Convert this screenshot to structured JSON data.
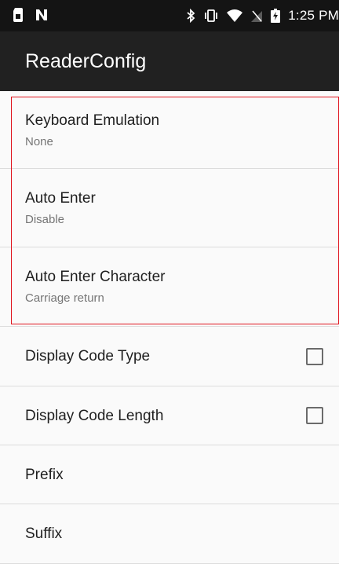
{
  "status_bar": {
    "time": "1:25 PM",
    "icons": [
      "sim-card-icon",
      "nfc-icon",
      "bluetooth-icon",
      "vibrate-icon",
      "wifi-icon",
      "no-signal-icon",
      "battery-charging-icon"
    ]
  },
  "app_bar": {
    "title": "ReaderConfig"
  },
  "preferences": [
    {
      "title": "Keyboard Emulation",
      "summary": "None"
    },
    {
      "title": "Auto Enter",
      "summary": "Disable"
    },
    {
      "title": "Auto Enter Character",
      "summary": "Carriage return"
    },
    {
      "title": "Display Code Type",
      "checked": false
    },
    {
      "title": "Display Code Length",
      "checked": false
    },
    {
      "title": "Prefix"
    },
    {
      "title": "Suffix"
    }
  ],
  "colors": {
    "status_bar_bg": "#141414",
    "app_bar_bg": "#212121",
    "background": "#fafafa",
    "highlight_border": "#e0141e"
  }
}
